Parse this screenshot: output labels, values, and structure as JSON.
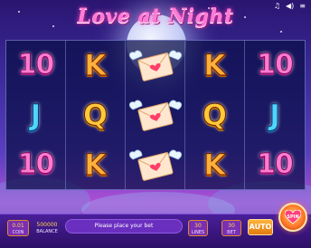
{
  "title": "Love at Night",
  "top_icons": [
    "music-icon",
    "sound-icon",
    "menu-icon"
  ],
  "reels": [
    [
      "10",
      "J",
      "10"
    ],
    [
      "K",
      "Q",
      "K"
    ],
    [
      "envelope",
      "envelope",
      "envelope"
    ],
    [
      "K",
      "Q",
      "K"
    ],
    [
      "10",
      "J",
      "10"
    ]
  ],
  "bottom": {
    "coin_value": "0.01",
    "coin_label": "COIN",
    "balance_value": "500000",
    "balance_label": "BALANCE",
    "message": "Please place your bet",
    "lines_value": "30",
    "lines_label": "LINES",
    "bet_value": "30",
    "bet_label": "BET",
    "auto_label": "AUTO",
    "spin_label": "SPIN"
  },
  "colors": {
    "title_pink": "#ff7ad6",
    "panel": "#7a2fb5",
    "accent_orange": "#e08a2a"
  }
}
